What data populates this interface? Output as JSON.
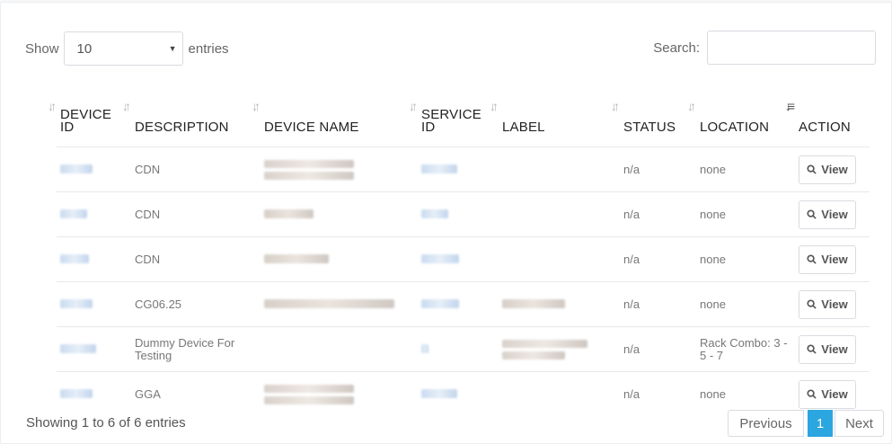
{
  "controls": {
    "show_label": "Show",
    "page_size": "10",
    "entries_label": "entries",
    "search_label": "Search:",
    "search_value": ""
  },
  "columns": [
    "DEVICE ID",
    "DESCRIPTION",
    "DEVICE NAME",
    "SERVICE ID",
    "LABEL",
    "STATUS",
    "LOCATION",
    "ACTION"
  ],
  "sorted_column": "LOCATION",
  "rows": [
    {
      "description": "CDN",
      "status": "n/a",
      "location": "none",
      "action": "View"
    },
    {
      "description": "CDN",
      "status": "n/a",
      "location": "none",
      "action": "View"
    },
    {
      "description": "CDN",
      "status": "n/a",
      "location": "none",
      "action": "View"
    },
    {
      "description": "CG06.25",
      "status": "n/a",
      "location": "none",
      "action": "View"
    },
    {
      "description": "Dummy Device For Testing",
      "status": "n/a",
      "location": "Rack Combo: 3 - 5 - 7",
      "action": "View"
    },
    {
      "description": "GGA",
      "status": "n/a",
      "location": "none",
      "action": "View"
    }
  ],
  "footer": {
    "info": "Showing 1 to 6 of 6 entries",
    "prev_label": "Previous",
    "current_page": "1",
    "next_label": "Next"
  },
  "colors": {
    "accent": "#2ba6e1",
    "border": "#d8dbe0"
  },
  "icons": {
    "sort": "sort-arrows-icon",
    "view": "search-icon"
  }
}
